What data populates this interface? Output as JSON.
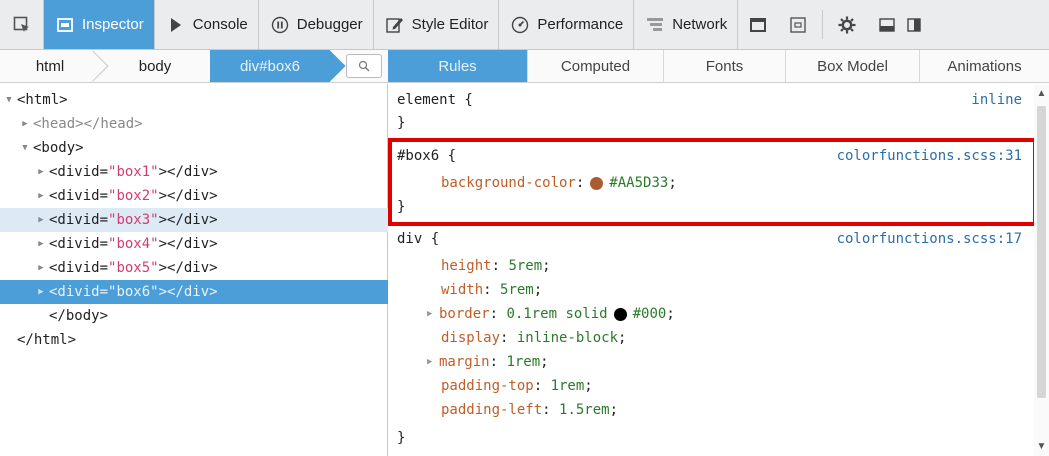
{
  "toolbar": {
    "tabs": [
      {
        "label": "Inspector",
        "icon": "inspector-icon",
        "active": true
      },
      {
        "label": "Console",
        "icon": "console-icon",
        "active": false
      },
      {
        "label": "Debugger",
        "icon": "debugger-icon",
        "active": false
      },
      {
        "label": "Style Editor",
        "icon": "style-editor-icon",
        "active": false
      },
      {
        "label": "Performance",
        "icon": "performance-icon",
        "active": false
      },
      {
        "label": "Network",
        "icon": "network-icon",
        "active": false
      }
    ],
    "right_icons": [
      "responsive-mode-icon",
      "scratchpad-icon",
      "settings-icon",
      "dock-icon",
      "split-icon"
    ],
    "accent": "#4c9ed9"
  },
  "breadcrumb": {
    "items": [
      "html",
      "body",
      "div#box6"
    ],
    "search_icon": "search-icon"
  },
  "sidebar_tabs": [
    {
      "label": "Rules",
      "active": true
    },
    {
      "label": "Computed",
      "active": false
    },
    {
      "label": "Fonts",
      "active": false
    },
    {
      "label": "Box Model",
      "active": false
    },
    {
      "label": "Animations",
      "active": false
    }
  ],
  "markup": {
    "lines": [
      {
        "twisty": "open",
        "text": "<html>"
      },
      {
        "twisty": "closed",
        "text": "<head></head>"
      },
      {
        "twisty": "open",
        "text": "<body>"
      },
      {
        "twisty": "closed",
        "tag_open": "<div ",
        "attr": "id=",
        "val": "\"box1\"",
        "tag_close": "></div>"
      },
      {
        "twisty": "closed",
        "tag_open": "<div ",
        "attr": "id=",
        "val": "\"box2\"",
        "tag_close": "></div>"
      },
      {
        "twisty": "closed",
        "tag_open": "<div ",
        "attr": "id=",
        "val": "\"box3\"",
        "tag_close": "></div>"
      },
      {
        "twisty": "closed",
        "tag_open": "<div ",
        "attr": "id=",
        "val": "\"box4\"",
        "tag_close": "></div>"
      },
      {
        "twisty": "closed",
        "tag_open": "<div ",
        "attr": "id=",
        "val": "\"box5\"",
        "tag_close": "></div>"
      },
      {
        "twisty": "closed",
        "tag_open": "<div ",
        "attr": "id=",
        "val": "\"box6\"",
        "tag_close": "></div>"
      },
      {
        "twisty": "none",
        "text": "</body>"
      },
      {
        "twisty": "none",
        "text": "</html>"
      }
    ],
    "hovered_index": 5,
    "selected_index": 8
  },
  "rules": {
    "element_rule": {
      "selector": "element {",
      "source": "inline",
      "close": "}"
    },
    "box6_rule": {
      "selector": "#box6 {",
      "source": "colorfunctions.scss:31",
      "prop": "background-color",
      "value": "#AA5D33",
      "swatch_color": "#AA5D33",
      "close": "}"
    },
    "div_rule": {
      "selector": "div {",
      "source": "colorfunctions.scss:17",
      "declarations": [
        {
          "prop": "height",
          "value": "5rem"
        },
        {
          "prop": "width",
          "value": "5rem"
        },
        {
          "prop": "border",
          "value_prefix": "0.1rem solid",
          "swatch_color": "#000000",
          "value": "#000"
        },
        {
          "prop": "display",
          "value": "inline-block"
        },
        {
          "prop": "margin",
          "value": "1rem"
        },
        {
          "prop": "padding-top",
          "value": "1rem"
        },
        {
          "prop": "padding-left",
          "value": "1.5rem"
        }
      ],
      "close": "}"
    },
    "highlight_color": "#e00000"
  }
}
